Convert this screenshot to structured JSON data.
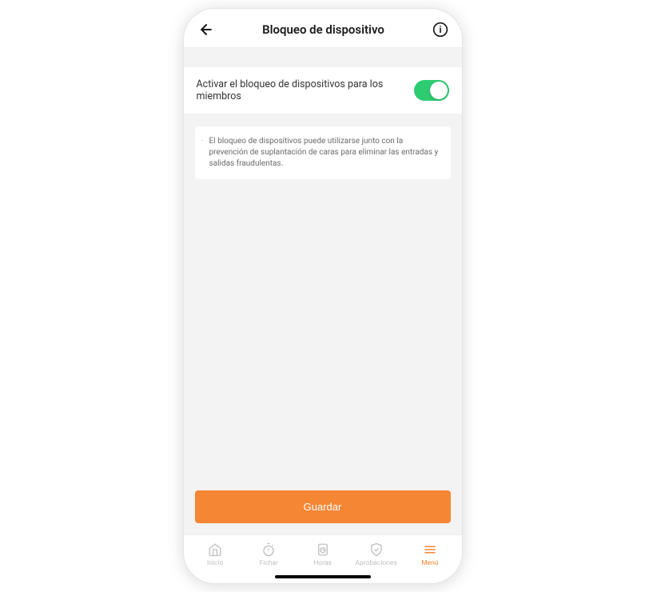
{
  "header": {
    "title": "Bloqueo de dispositivo"
  },
  "toggle": {
    "label": "Activar el bloqueo de dispositivos para los miembros",
    "state": "on"
  },
  "info": {
    "text": "El bloqueo de dispositivos puede utilizarse junto con la prevención de suplantación de caras para eliminar las entradas y salidas fraudulentas."
  },
  "actions": {
    "save": "Guardar"
  },
  "nav": {
    "items": [
      {
        "label": "Inicio",
        "active": false
      },
      {
        "label": "Fichar",
        "active": false
      },
      {
        "label": "Horas",
        "active": false
      },
      {
        "label": "Aprobaciones",
        "active": false
      },
      {
        "label": "Menú",
        "active": true
      }
    ]
  },
  "colors": {
    "accent": "#f58634",
    "toggle_on": "#2ecc71"
  }
}
